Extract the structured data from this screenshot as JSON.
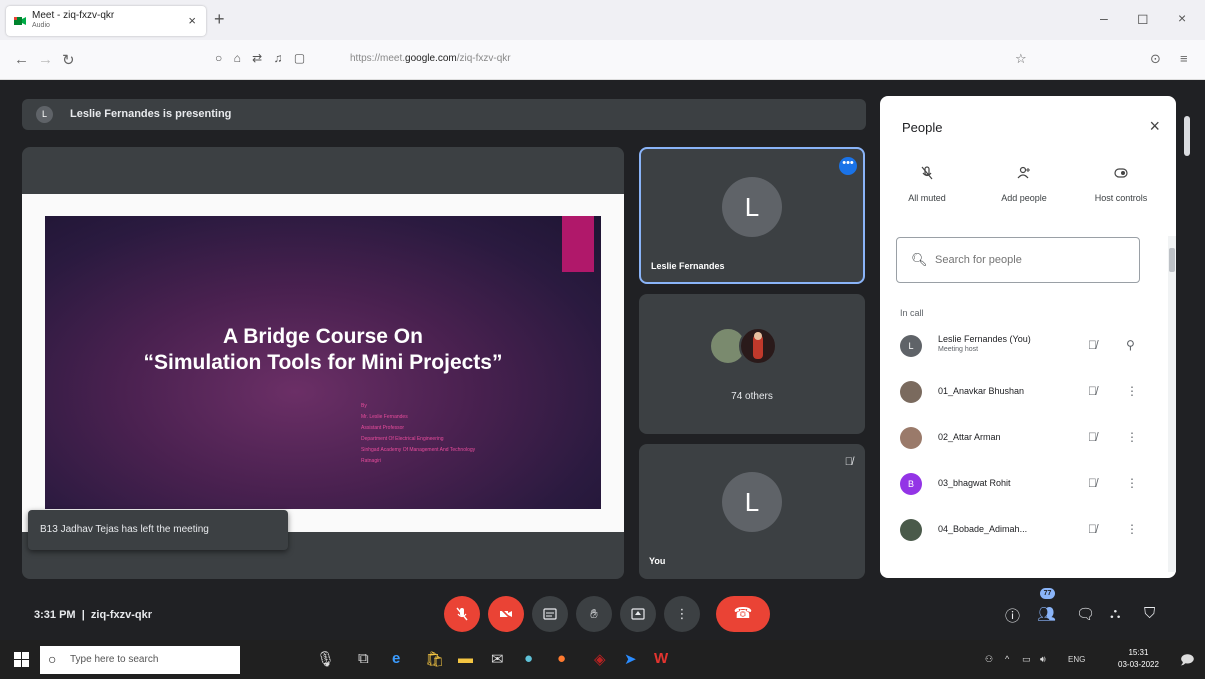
{
  "browser": {
    "tab_title": "Meet - ziq-fxzv-qkr",
    "tab_subtitle": "Audio",
    "tab_close": "×",
    "new_tab": "+",
    "url_prefix": "https://meet.",
    "url_domain": "google.com",
    "url_path": "/ziq-fxzv-qkr",
    "win_min": "–",
    "win_max": "◻",
    "win_close": "×"
  },
  "meet": {
    "presenting_avatar": "L",
    "presenting_text": "Leslie Fernandes is presenting",
    "slide": {
      "title_line1": "A Bridge Course On",
      "title_line2": "“Simulation Tools for Mini Projects”",
      "byline": [
        "By",
        "Mr. Leslie Fernandes",
        "Assistant Professor",
        "Department Of Electrical Engineering",
        "Sinhgad Academy Of Management And Technology",
        "Ratnagiri"
      ]
    },
    "toast": "B13 Jadhav Tejas has left the meeting",
    "tiles": [
      {
        "avatar": "L",
        "name": "Leslie Fernandes"
      },
      {
        "label": "74 others"
      },
      {
        "avatar": "L",
        "name": "You"
      }
    ],
    "clock": "3:31 PM",
    "meeting_code": "ziq-fxzv-qkr",
    "participant_count": "77"
  },
  "people": {
    "title": "People",
    "close": "×",
    "actions": [
      {
        "label": "All muted",
        "icon": "mic-off-icon"
      },
      {
        "label": "Add people",
        "icon": "person-add-icon"
      },
      {
        "label": "Host controls",
        "icon": "host-controls-icon"
      }
    ],
    "search_placeholder": "Search for people",
    "section": "In call",
    "participants": [
      {
        "initial": "L",
        "name": "Leslie Fernandes (You)",
        "sub": "Meeting host",
        "color": "#5f6368"
      },
      {
        "initial": "",
        "name": "01_Anavkar Bhushan",
        "color": "#7a6a5e"
      },
      {
        "initial": "",
        "name": "02_Attar Arman",
        "color": "#9a7a6a"
      },
      {
        "initial": "B",
        "name": "03_bhagwat Rohit",
        "color": "#9334e6"
      },
      {
        "initial": "",
        "name": "04_Bobade_Adimah...",
        "color": "#4a5a4a"
      }
    ]
  },
  "taskbar": {
    "search_placeholder": "Type here to search",
    "lang": "ENG",
    "time": "15:31",
    "date": "03-03-2022"
  },
  "colors": {
    "meet_bg": "#202124",
    "tile_bg": "#3c4043",
    "red": "#ea4335",
    "blue": "#1a73e8"
  }
}
